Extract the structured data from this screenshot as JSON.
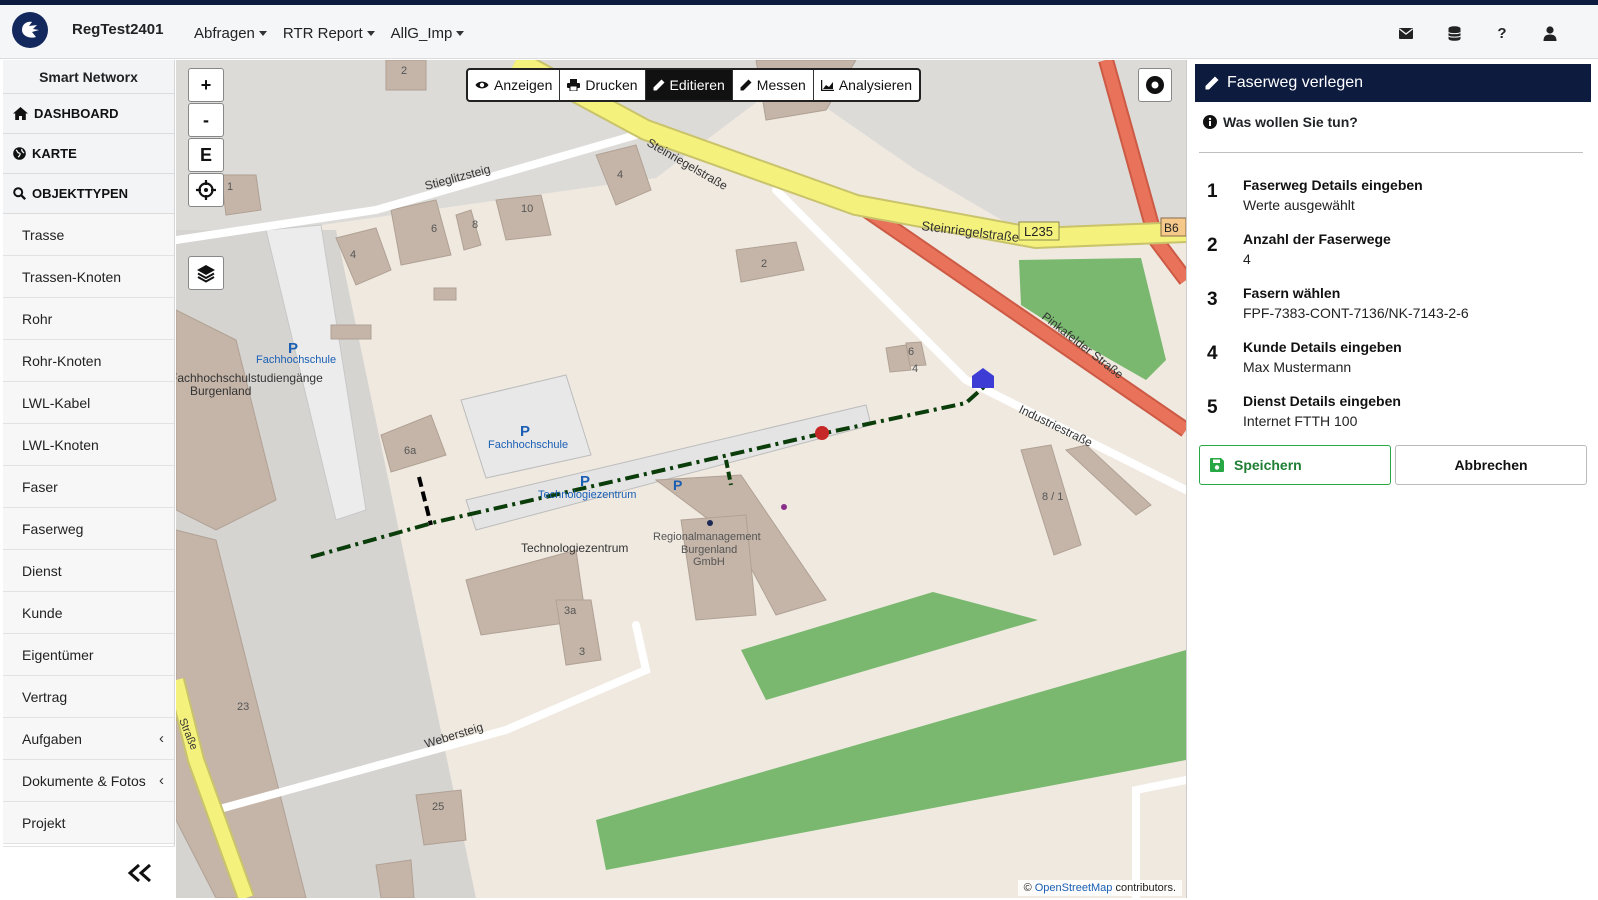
{
  "header": {
    "app_title": "RegTest2401",
    "nav": [
      {
        "label": "Abfragen"
      },
      {
        "label": "RTR Report"
      },
      {
        "label": "AllG_Imp"
      }
    ],
    "icons": [
      "envelope-icon",
      "database-icon",
      "help-icon",
      "user-icon"
    ],
    "help_glyph": "?"
  },
  "sidebar": {
    "brand": "Smart Networx",
    "sections": [
      {
        "label": "DASHBOARD",
        "icon": "home-icon"
      },
      {
        "label": "KARTE",
        "icon": "globe-icon"
      },
      {
        "label": "OBJEKTTYPEN",
        "icon": "search-icon"
      }
    ],
    "items": [
      {
        "label": "Trasse"
      },
      {
        "label": "Trassen-Knoten"
      },
      {
        "label": "Rohr"
      },
      {
        "label": "Rohr-Knoten"
      },
      {
        "label": "LWL-Kabel"
      },
      {
        "label": "LWL-Knoten"
      },
      {
        "label": "Faser"
      },
      {
        "label": "Faserweg"
      },
      {
        "label": "Dienst"
      },
      {
        "label": "Kunde"
      },
      {
        "label": "Eigentümer"
      },
      {
        "label": "Vertrag"
      },
      {
        "label": "Aufgaben",
        "chevron": "‹"
      },
      {
        "label": "Dokumente & Fotos",
        "chevron": "‹"
      },
      {
        "label": "Projekt"
      }
    ]
  },
  "map": {
    "controls": {
      "zoom_in": "+",
      "zoom_out": "-",
      "extent": "E"
    },
    "toolbar": [
      {
        "label": "Anzeigen",
        "icon": "eye-icon",
        "active": false
      },
      {
        "label": "Drucken",
        "icon": "print-icon",
        "active": false
      },
      {
        "label": "Editieren",
        "icon": "pencil-icon",
        "active": true
      },
      {
        "label": "Messen",
        "icon": "ruler-icon",
        "active": false
      },
      {
        "label": "Analysieren",
        "icon": "chart-icon",
        "active": false
      }
    ],
    "labels": {
      "steinriegel_upper": "Steinriegelstraße",
      "steinriegel": "Steinriegelstraße",
      "l235": "L235",
      "b6": "B6",
      "stieglitzsteig": "Stieglitzsteig",
      "pinkafelder": "Pinkafelder Straße",
      "industriestrasse": "Industriestraße",
      "webersteig": "Webersteig",
      "side_street": "Straße",
      "fh_parking_1": "Fachhochschule",
      "fh_parking_2": "Fachhochschule",
      "studiengaenge_1": "Fachhochschulstudiengänge",
      "studiengaenge_2": "Burgenland",
      "tz_parking": "Technologiezentrum",
      "tz": "Technologiezentrum",
      "reg_1": "Regionalmanagement",
      "reg_2": "Burgenland",
      "reg_3": "GmbH",
      "parking": "P",
      "parking_bike": "P",
      "hn_2a": "2",
      "hn_4a": "4",
      "hn_6a": "6",
      "hn_8": "8",
      "hn_10": "10",
      "hn_4b": "4",
      "hn_1": "1",
      "hn_2b": "2",
      "hn_6b": "6",
      "hn_4c": "4",
      "hn_6a_letter": "6a",
      "hn_8_1": "8 / 1",
      "hn_3a": "3a",
      "hn_3": "3",
      "hn_23": "23",
      "hn_25": "25"
    },
    "attribution": {
      "prefix": "©",
      "link": "OpenStreetMap",
      "suffix": "contributors."
    },
    "colors": {
      "fiber_route": "#0a3d0a",
      "customer_marker": "#c62828",
      "pop_marker": "#3d3dd6",
      "primary_road": "#f5f17d",
      "secondary_road": "#e8735a",
      "building": "#c4b5a8",
      "park": "#79b86e"
    }
  },
  "panel": {
    "title": "Faserweg verlegen",
    "question": "Was wollen Sie tun?",
    "steps": [
      {
        "num": "1",
        "title": "Faserweg Details eingeben",
        "value": "Werte ausgewählt"
      },
      {
        "num": "2",
        "title": "Anzahl der Faserwege",
        "value": "4"
      },
      {
        "num": "3",
        "title": "Fasern wählen",
        "value": "FPF-7383-CONT-7136/NK-7143-2-6"
      },
      {
        "num": "4",
        "title": "Kunde Details eingeben",
        "value": "Max Mustermann"
      },
      {
        "num": "5",
        "title": "Dienst Details eingeben",
        "value": "Internet FTTH 100"
      }
    ],
    "save_label": "Speichern",
    "cancel_label": "Abbrechen",
    "colors": {
      "header_bg": "#0d1b3e",
      "save": "#28a745"
    }
  }
}
